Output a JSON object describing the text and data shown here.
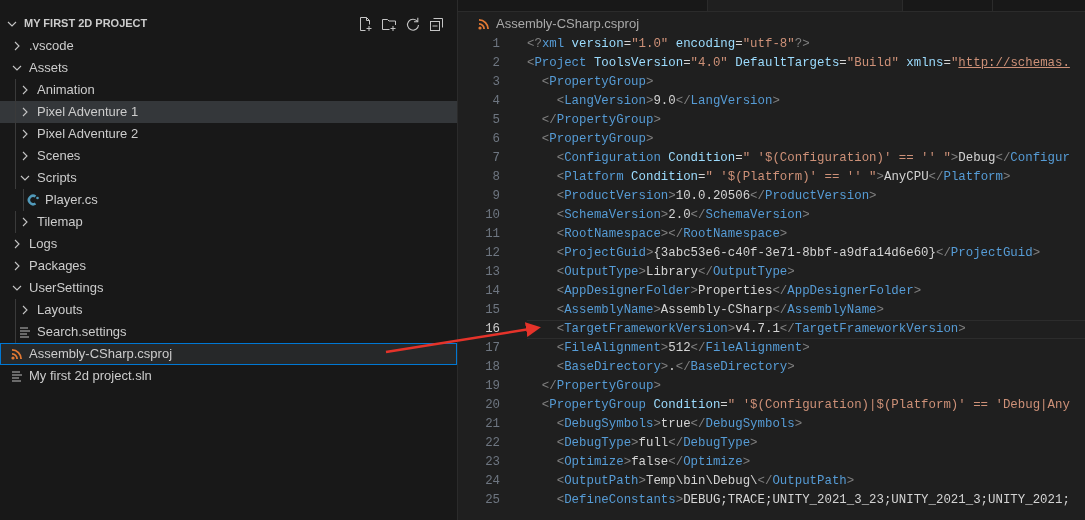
{
  "explorer": {
    "title": "MY FIRST 2D PROJECT",
    "expanded": true,
    "items": [
      {
        "kind": "folder",
        "label": ".vscode",
        "expanded": false,
        "selected": false,
        "hovered": false
      },
      {
        "kind": "folder",
        "label": "Assets",
        "expanded": true,
        "selected": false,
        "hovered": false,
        "children": [
          {
            "kind": "folder",
            "label": "Animation",
            "expanded": false,
            "selected": false,
            "hovered": false
          },
          {
            "kind": "folder",
            "label": "Pixel Adventure 1",
            "expanded": false,
            "selected": false,
            "hovered": true
          },
          {
            "kind": "folder",
            "label": "Pixel Adventure 2",
            "expanded": false,
            "selected": false,
            "hovered": false
          },
          {
            "kind": "folder",
            "label": "Scenes",
            "expanded": false,
            "selected": false,
            "hovered": false
          },
          {
            "kind": "folder",
            "label": "Scripts",
            "expanded": true,
            "selected": false,
            "hovered": false,
            "children": [
              {
                "kind": "csharp-file",
                "label": "Player.cs",
                "selected": false,
                "hovered": false
              }
            ]
          },
          {
            "kind": "folder",
            "label": "Tilemap",
            "expanded": false,
            "selected": false,
            "hovered": false
          }
        ]
      },
      {
        "kind": "folder",
        "label": "Logs",
        "expanded": false,
        "selected": false,
        "hovered": false
      },
      {
        "kind": "folder",
        "label": "Packages",
        "expanded": false,
        "selected": false,
        "hovered": false
      },
      {
        "kind": "folder",
        "label": "UserSettings",
        "expanded": true,
        "selected": false,
        "hovered": false,
        "children": [
          {
            "kind": "folder",
            "label": "Layouts",
            "expanded": false,
            "selected": false,
            "hovered": false
          },
          {
            "kind": "text-file",
            "label": "Search.settings",
            "selected": false,
            "hovered": false
          }
        ]
      },
      {
        "kind": "project-file",
        "label": "Assembly-CSharp.csproj",
        "selected": true,
        "hovered": false
      },
      {
        "kind": "text-file",
        "label": "My first 2d project.sln",
        "selected": false,
        "hovered": false
      }
    ]
  },
  "editor": {
    "breadcrumb": "Assembly-CSharp.csproj",
    "lines": [
      {
        "number": "1",
        "current": false,
        "tokens": [
          {
            "kind": "bracket",
            "text": "<?"
          },
          {
            "kind": "tag",
            "text": "xml"
          },
          {
            "kind": "attr",
            "text": " version"
          },
          {
            "kind": "plain",
            "text": "="
          },
          {
            "kind": "value",
            "text": "\"1.0\""
          },
          {
            "kind": "attr",
            "text": " encoding"
          },
          {
            "kind": "plain",
            "text": "="
          },
          {
            "kind": "value",
            "text": "\"utf-8\""
          },
          {
            "kind": "bracket",
            "text": "?>"
          }
        ]
      },
      {
        "number": "2",
        "current": false,
        "tokens": [
          {
            "kind": "bracket",
            "text": "<"
          },
          {
            "kind": "tag",
            "text": "Project"
          },
          {
            "kind": "attr",
            "text": " ToolsVersion"
          },
          {
            "kind": "plain",
            "text": "="
          },
          {
            "kind": "value",
            "text": "\"4.0\""
          },
          {
            "kind": "attr",
            "text": " DefaultTargets"
          },
          {
            "kind": "plain",
            "text": "="
          },
          {
            "kind": "value",
            "text": "\"Build\""
          },
          {
            "kind": "attr",
            "text": " xmlns"
          },
          {
            "kind": "plain",
            "text": "="
          },
          {
            "kind": "value",
            "text": "\""
          },
          {
            "kind": "link",
            "text": "http://schemas."
          }
        ]
      },
      {
        "number": "3",
        "current": false,
        "tokens": [
          {
            "kind": "bracket",
            "text": "  <"
          },
          {
            "kind": "tag",
            "text": "PropertyGroup"
          },
          {
            "kind": "bracket",
            "text": ">"
          }
        ]
      },
      {
        "number": "4",
        "current": false,
        "tokens": [
          {
            "kind": "bracket",
            "text": "    <"
          },
          {
            "kind": "tag",
            "text": "LangVersion"
          },
          {
            "kind": "bracket",
            "text": ">"
          },
          {
            "kind": "plain",
            "text": "9.0"
          },
          {
            "kind": "bracket",
            "text": "</"
          },
          {
            "kind": "tag",
            "text": "LangVersion"
          },
          {
            "kind": "bracket",
            "text": ">"
          }
        ]
      },
      {
        "number": "5",
        "current": false,
        "tokens": [
          {
            "kind": "bracket",
            "text": "  </"
          },
          {
            "kind": "tag",
            "text": "PropertyGroup"
          },
          {
            "kind": "bracket",
            "text": ">"
          }
        ]
      },
      {
        "number": "6",
        "current": false,
        "tokens": [
          {
            "kind": "bracket",
            "text": "  <"
          },
          {
            "kind": "tag",
            "text": "PropertyGroup"
          },
          {
            "kind": "bracket",
            "text": ">"
          }
        ]
      },
      {
        "number": "7",
        "current": false,
        "tokens": [
          {
            "kind": "bracket",
            "text": "    <"
          },
          {
            "kind": "tag",
            "text": "Configuration"
          },
          {
            "kind": "attr",
            "text": " Condition"
          },
          {
            "kind": "plain",
            "text": "="
          },
          {
            "kind": "value",
            "text": "\" '$(Configuration)' == '' \""
          },
          {
            "kind": "bracket",
            "text": ">"
          },
          {
            "kind": "plain",
            "text": "Debug"
          },
          {
            "kind": "bracket",
            "text": "</"
          },
          {
            "kind": "tag",
            "text": "Configur"
          }
        ]
      },
      {
        "number": "8",
        "current": false,
        "tokens": [
          {
            "kind": "bracket",
            "text": "    <"
          },
          {
            "kind": "tag",
            "text": "Platform"
          },
          {
            "kind": "attr",
            "text": " Condition"
          },
          {
            "kind": "plain",
            "text": "="
          },
          {
            "kind": "value",
            "text": "\" '$(Platform)' == '' \""
          },
          {
            "kind": "bracket",
            "text": ">"
          },
          {
            "kind": "plain",
            "text": "AnyCPU"
          },
          {
            "kind": "bracket",
            "text": "</"
          },
          {
            "kind": "tag",
            "text": "Platform"
          },
          {
            "kind": "bracket",
            "text": ">"
          }
        ]
      },
      {
        "number": "9",
        "current": false,
        "tokens": [
          {
            "kind": "bracket",
            "text": "    <"
          },
          {
            "kind": "tag",
            "text": "ProductVersion"
          },
          {
            "kind": "bracket",
            "text": ">"
          },
          {
            "kind": "plain",
            "text": "10.0.20506"
          },
          {
            "kind": "bracket",
            "text": "</"
          },
          {
            "kind": "tag",
            "text": "ProductVersion"
          },
          {
            "kind": "bracket",
            "text": ">"
          }
        ]
      },
      {
        "number": "10",
        "current": false,
        "tokens": [
          {
            "kind": "bracket",
            "text": "    <"
          },
          {
            "kind": "tag",
            "text": "SchemaVersion"
          },
          {
            "kind": "bracket",
            "text": ">"
          },
          {
            "kind": "plain",
            "text": "2.0"
          },
          {
            "kind": "bracket",
            "text": "</"
          },
          {
            "kind": "tag",
            "text": "SchemaVersion"
          },
          {
            "kind": "bracket",
            "text": ">"
          }
        ]
      },
      {
        "number": "11",
        "current": false,
        "tokens": [
          {
            "kind": "bracket",
            "text": "    <"
          },
          {
            "kind": "tag",
            "text": "RootNamespace"
          },
          {
            "kind": "bracket",
            "text": "></"
          },
          {
            "kind": "tag",
            "text": "RootNamespace"
          },
          {
            "kind": "bracket",
            "text": ">"
          }
        ]
      },
      {
        "number": "12",
        "current": false,
        "tokens": [
          {
            "kind": "bracket",
            "text": "    <"
          },
          {
            "kind": "tag",
            "text": "ProjectGuid"
          },
          {
            "kind": "bracket",
            "text": ">"
          },
          {
            "kind": "plain",
            "text": "{3abc53e6-c40f-3e71-8bbf-a9dfa14d6e60}"
          },
          {
            "kind": "bracket",
            "text": "</"
          },
          {
            "kind": "tag",
            "text": "ProjectGuid"
          },
          {
            "kind": "bracket",
            "text": ">"
          }
        ]
      },
      {
        "number": "13",
        "current": false,
        "tokens": [
          {
            "kind": "bracket",
            "text": "    <"
          },
          {
            "kind": "tag",
            "text": "OutputType"
          },
          {
            "kind": "bracket",
            "text": ">"
          },
          {
            "kind": "plain",
            "text": "Library"
          },
          {
            "kind": "bracket",
            "text": "</"
          },
          {
            "kind": "tag",
            "text": "OutputType"
          },
          {
            "kind": "bracket",
            "text": ">"
          }
        ]
      },
      {
        "number": "14",
        "current": false,
        "tokens": [
          {
            "kind": "bracket",
            "text": "    <"
          },
          {
            "kind": "tag",
            "text": "AppDesignerFolder"
          },
          {
            "kind": "bracket",
            "text": ">"
          },
          {
            "kind": "plain",
            "text": "Properties"
          },
          {
            "kind": "bracket",
            "text": "</"
          },
          {
            "kind": "tag",
            "text": "AppDesignerFolder"
          },
          {
            "kind": "bracket",
            "text": ">"
          }
        ]
      },
      {
        "number": "15",
        "current": false,
        "tokens": [
          {
            "kind": "bracket",
            "text": "    <"
          },
          {
            "kind": "tag",
            "text": "AssemblyName"
          },
          {
            "kind": "bracket",
            "text": ">"
          },
          {
            "kind": "plain",
            "text": "Assembly-CSharp"
          },
          {
            "kind": "bracket",
            "text": "</"
          },
          {
            "kind": "tag",
            "text": "AssemblyName"
          },
          {
            "kind": "bracket",
            "text": ">"
          }
        ]
      },
      {
        "number": "16",
        "current": true,
        "tokens": [
          {
            "kind": "bracket",
            "text": "    <"
          },
          {
            "kind": "tag",
            "text": "TargetFrameworkVersion"
          },
          {
            "kind": "bracket",
            "text": ">"
          },
          {
            "kind": "plain",
            "text": "v4.7.1"
          },
          {
            "kind": "bracket",
            "text": "</"
          },
          {
            "kind": "tag",
            "text": "TargetFrameworkVersion"
          },
          {
            "kind": "bracket",
            "text": ">"
          }
        ]
      },
      {
        "number": "17",
        "current": false,
        "tokens": [
          {
            "kind": "bracket",
            "text": "    <"
          },
          {
            "kind": "tag",
            "text": "FileAlignment"
          },
          {
            "kind": "bracket",
            "text": ">"
          },
          {
            "kind": "plain",
            "text": "512"
          },
          {
            "kind": "bracket",
            "text": "</"
          },
          {
            "kind": "tag",
            "text": "FileAlignment"
          },
          {
            "kind": "bracket",
            "text": ">"
          }
        ]
      },
      {
        "number": "18",
        "current": false,
        "tokens": [
          {
            "kind": "bracket",
            "text": "    <"
          },
          {
            "kind": "tag",
            "text": "BaseDirectory"
          },
          {
            "kind": "bracket",
            "text": ">"
          },
          {
            "kind": "plain",
            "text": "."
          },
          {
            "kind": "bracket",
            "text": "</"
          },
          {
            "kind": "tag",
            "text": "BaseDirectory"
          },
          {
            "kind": "bracket",
            "text": ">"
          }
        ]
      },
      {
        "number": "19",
        "current": false,
        "tokens": [
          {
            "kind": "bracket",
            "text": "  </"
          },
          {
            "kind": "tag",
            "text": "PropertyGroup"
          },
          {
            "kind": "bracket",
            "text": ">"
          }
        ]
      },
      {
        "number": "20",
        "current": false,
        "tokens": [
          {
            "kind": "bracket",
            "text": "  <"
          },
          {
            "kind": "tag",
            "text": "PropertyGroup"
          },
          {
            "kind": "attr",
            "text": " Condition"
          },
          {
            "kind": "plain",
            "text": "="
          },
          {
            "kind": "value",
            "text": "\" '$(Configuration)|$(Platform)' == 'Debug|Any"
          }
        ]
      },
      {
        "number": "21",
        "current": false,
        "tokens": [
          {
            "kind": "bracket",
            "text": "    <"
          },
          {
            "kind": "tag",
            "text": "DebugSymbols"
          },
          {
            "kind": "bracket",
            "text": ">"
          },
          {
            "kind": "plain",
            "text": "true"
          },
          {
            "kind": "bracket",
            "text": "</"
          },
          {
            "kind": "tag",
            "text": "DebugSymbols"
          },
          {
            "kind": "bracket",
            "text": ">"
          }
        ]
      },
      {
        "number": "22",
        "current": false,
        "tokens": [
          {
            "kind": "bracket",
            "text": "    <"
          },
          {
            "kind": "tag",
            "text": "DebugType"
          },
          {
            "kind": "bracket",
            "text": ">"
          },
          {
            "kind": "plain",
            "text": "full"
          },
          {
            "kind": "bracket",
            "text": "</"
          },
          {
            "kind": "tag",
            "text": "DebugType"
          },
          {
            "kind": "bracket",
            "text": ">"
          }
        ]
      },
      {
        "number": "23",
        "current": false,
        "tokens": [
          {
            "kind": "bracket",
            "text": "    <"
          },
          {
            "kind": "tag",
            "text": "Optimize"
          },
          {
            "kind": "bracket",
            "text": ">"
          },
          {
            "kind": "plain",
            "text": "false"
          },
          {
            "kind": "bracket",
            "text": "</"
          },
          {
            "kind": "tag",
            "text": "Optimize"
          },
          {
            "kind": "bracket",
            "text": ">"
          }
        ]
      },
      {
        "number": "24",
        "current": false,
        "tokens": [
          {
            "kind": "bracket",
            "text": "    <"
          },
          {
            "kind": "tag",
            "text": "OutputPath"
          },
          {
            "kind": "bracket",
            "text": ">"
          },
          {
            "kind": "plain",
            "text": "Temp\\bin\\Debug\\"
          },
          {
            "kind": "bracket",
            "text": "</"
          },
          {
            "kind": "tag",
            "text": "OutputPath"
          },
          {
            "kind": "bracket",
            "text": ">"
          }
        ]
      },
      {
        "number": "25",
        "current": false,
        "tokens": [
          {
            "kind": "bracket",
            "text": "    <"
          },
          {
            "kind": "tag",
            "text": "DefineConstants"
          },
          {
            "kind": "bracket",
            "text": ">"
          },
          {
            "kind": "plain",
            "text": "DEBUG;TRACE;UNITY_2021_3_23;UNITY_2021_3;UNITY_2021;"
          }
        ]
      }
    ]
  }
}
